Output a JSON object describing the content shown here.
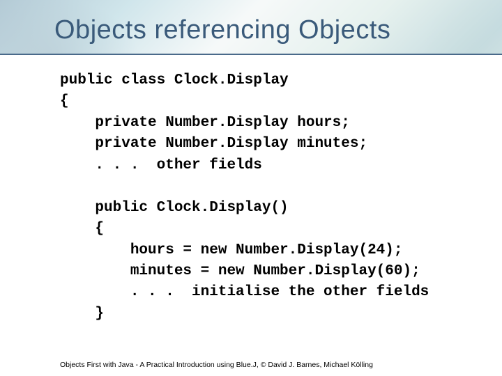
{
  "title": "Objects referencing Objects",
  "code": {
    "l1": "public class Clock.Display",
    "l2": "{",
    "l3": "    private Number.Display hours;",
    "l4": "    private Number.Display minutes;",
    "l5": "    . . .  other fields",
    "l6": "",
    "l7": "    public Clock.Display()",
    "l8": "    {",
    "l9": "        hours = new Number.Display(24);",
    "l10": "        minutes = new Number.Display(60);",
    "l11": "        . . .  initialise the other fields",
    "l12": "    }"
  },
  "footer": "Objects First with Java - A Practical Introduction using Blue.J, © David J. Barnes, Michael Kölling"
}
